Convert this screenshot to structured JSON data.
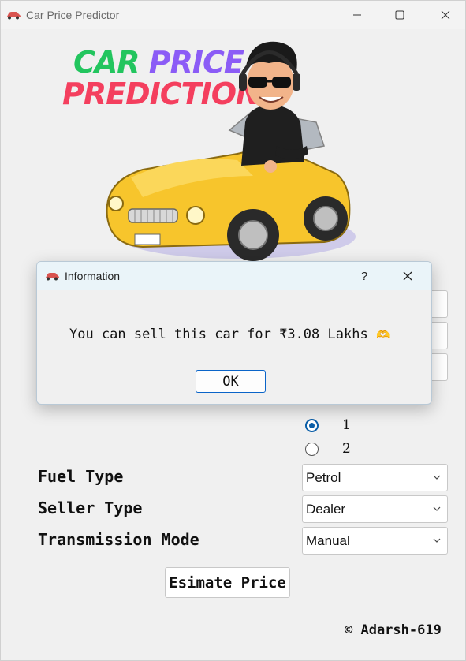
{
  "window": {
    "title": "Car Price Predictor",
    "icon": "car-icon"
  },
  "hero": {
    "logo_word1": "CAR",
    "logo_word2": "PRICE",
    "logo_line2": "PREDICTION",
    "colors": {
      "car": "#22c55e",
      "price": "#8b5cf6",
      "prediction": "#f43f5e"
    }
  },
  "form": {
    "radio_options": [
      {
        "label": "1",
        "checked": true
      },
      {
        "label": "2",
        "checked": false
      }
    ],
    "fuel_type": {
      "label": "Fuel Type",
      "value": "Petrol"
    },
    "seller_type": {
      "label": "Seller Type",
      "value": "Dealer"
    },
    "transmission": {
      "label": "Transmission Mode",
      "value": "Manual"
    },
    "estimate_label": "Esimate Price"
  },
  "footer": {
    "text": "© Adarsh-619"
  },
  "dialog": {
    "title": "Information",
    "help": "?",
    "message": "You can sell this car for ₹3.08 Lakhs",
    "emoji": "🫶",
    "ok_label": "OK",
    "accent": "#0a64c8"
  }
}
